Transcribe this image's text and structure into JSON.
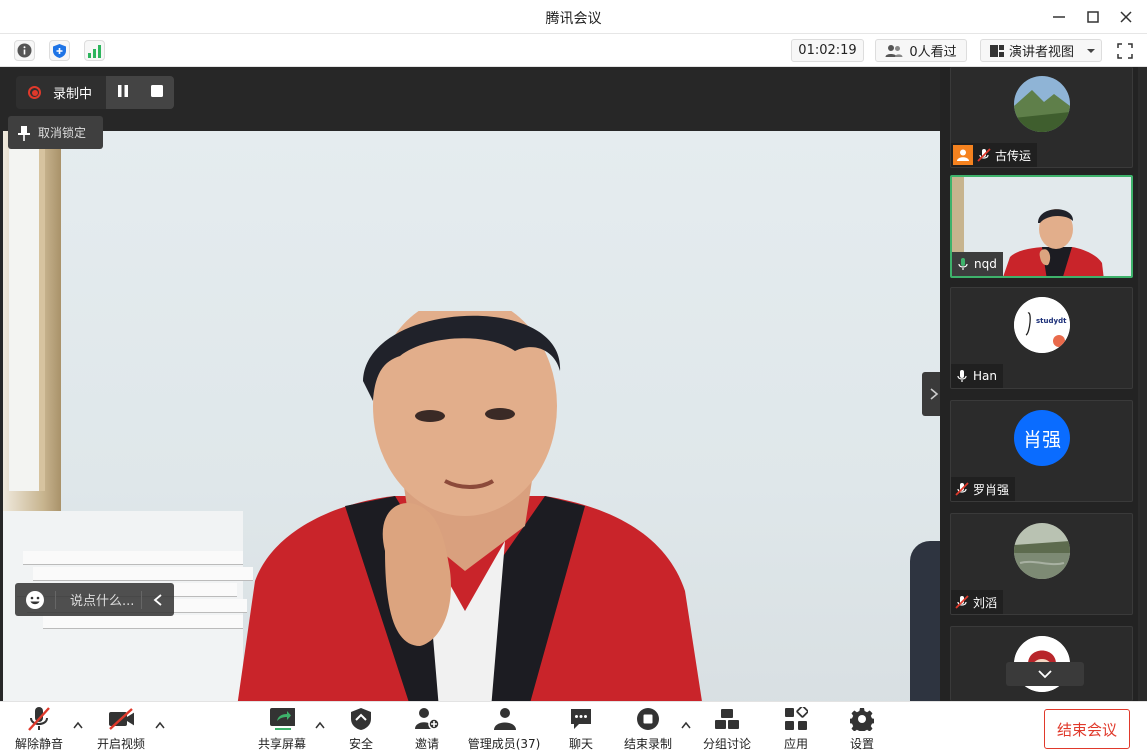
{
  "window": {
    "title": "腾讯会议"
  },
  "infobar": {
    "timer": "01:02:19",
    "viewers": "0人看过",
    "view_mode": "演讲者视图"
  },
  "recording": {
    "status_label": "录制中"
  },
  "main": {
    "unlock_label": "取消锁定",
    "chat_placeholder": "说点什么..."
  },
  "participants": [
    {
      "name": "古传运",
      "mic": "muted",
      "host": true,
      "avatar": "landscape-photo"
    },
    {
      "name": "nqd",
      "mic": "active",
      "host": false,
      "avatar": "video"
    },
    {
      "name": "Han",
      "mic": "on",
      "host": false,
      "avatar": "logo",
      "logo_text": "studydt"
    },
    {
      "name": "罗肖强",
      "mic": "muted",
      "host": false,
      "avatar": "initials",
      "initials": "肖强",
      "avatar_color": "#0a6cff"
    },
    {
      "name": "刘滔",
      "mic": "muted",
      "host": false,
      "avatar": "landscape-photo"
    },
    {
      "name": "",
      "mic": "",
      "host": false,
      "avatar": "cartoon"
    }
  ],
  "toolbar": {
    "unmute": "解除静音",
    "video": "开启视频",
    "share": "共享屏幕",
    "security": "安全",
    "invite": "邀请",
    "members": "管理成员(37)",
    "chat": "聊天",
    "end_record": "结束录制",
    "breakout": "分组讨论",
    "apps": "应用",
    "settings": "设置",
    "end_meeting": "结束会议"
  },
  "colors": {
    "accent_green": "#3eb26b",
    "danger_red": "#e0392b",
    "host_orange": "#f5821f",
    "blue": "#0a6cff"
  }
}
